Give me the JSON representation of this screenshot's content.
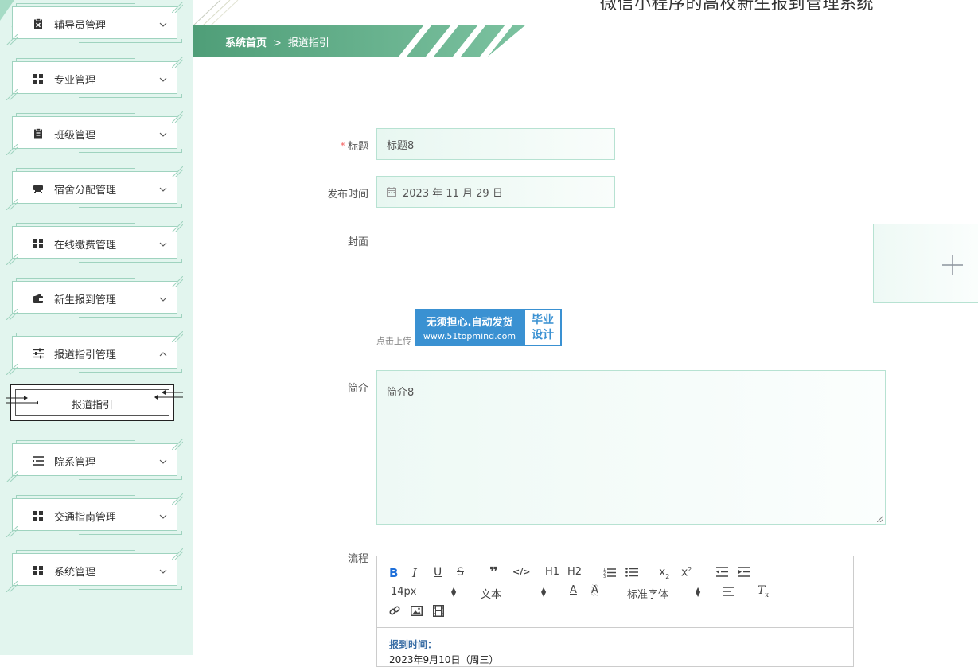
{
  "app": {
    "title": "微信小程序的高校新生报到管理系统"
  },
  "breadcrumb": {
    "home": "系统首页",
    "separator": ">",
    "current": "报道指引"
  },
  "sidebar": {
    "items": [
      {
        "label": "辅导员管理",
        "icon": "badge-clipboard-icon",
        "expanded": false
      },
      {
        "label": "专业管理",
        "icon": "grid-icon",
        "expanded": false
      },
      {
        "label": "班级管理",
        "icon": "clipboard-icon",
        "expanded": false
      },
      {
        "label": "宿舍分配管理",
        "icon": "bed-icon",
        "expanded": false
      },
      {
        "label": "在线缴费管理",
        "icon": "grid-icon",
        "expanded": false
      },
      {
        "label": "新生报到管理",
        "icon": "wallet-icon",
        "expanded": false
      },
      {
        "label": "报道指引管理",
        "icon": "sliders-icon",
        "expanded": true
      },
      {
        "label": "院系管理",
        "icon": "indent-list-icon",
        "expanded": false
      },
      {
        "label": "交通指南管理",
        "icon": "grid-icon",
        "expanded": false
      },
      {
        "label": "系统管理",
        "icon": "grid-icon",
        "expanded": false
      }
    ],
    "sub_item": {
      "label": "报道指引"
    }
  },
  "form": {
    "title": {
      "label": "标题",
      "required_mark": "*",
      "value": "标题8"
    },
    "publish_time": {
      "label": "发布时间",
      "value": "2023 年 11 月 29 日"
    },
    "cover": {
      "label": "封面",
      "upload_hint": "点击上传"
    },
    "intro": {
      "label": "简介",
      "value": "简介8"
    },
    "process": {
      "label": "流程"
    }
  },
  "watermark": {
    "line1": "无须担心.自动发货",
    "line2": "www.51topmind.com",
    "badge_line1": "毕业",
    "badge_line2": "设计"
  },
  "editor": {
    "toolbar": {
      "font_size": "14px",
      "block_type": "文本",
      "font_family": "标准字体",
      "h1": "H1",
      "h2": "H2"
    },
    "content": {
      "heading": "报到时间：",
      "line1": "2023年9月10日（周三）"
    }
  },
  "colors": {
    "sidebar_bg": "#e2f5ee",
    "accent": "#5aa882",
    "accent_light": "#b7e2d2",
    "required": "#f56c6c",
    "watermark": "#3a91d2"
  }
}
